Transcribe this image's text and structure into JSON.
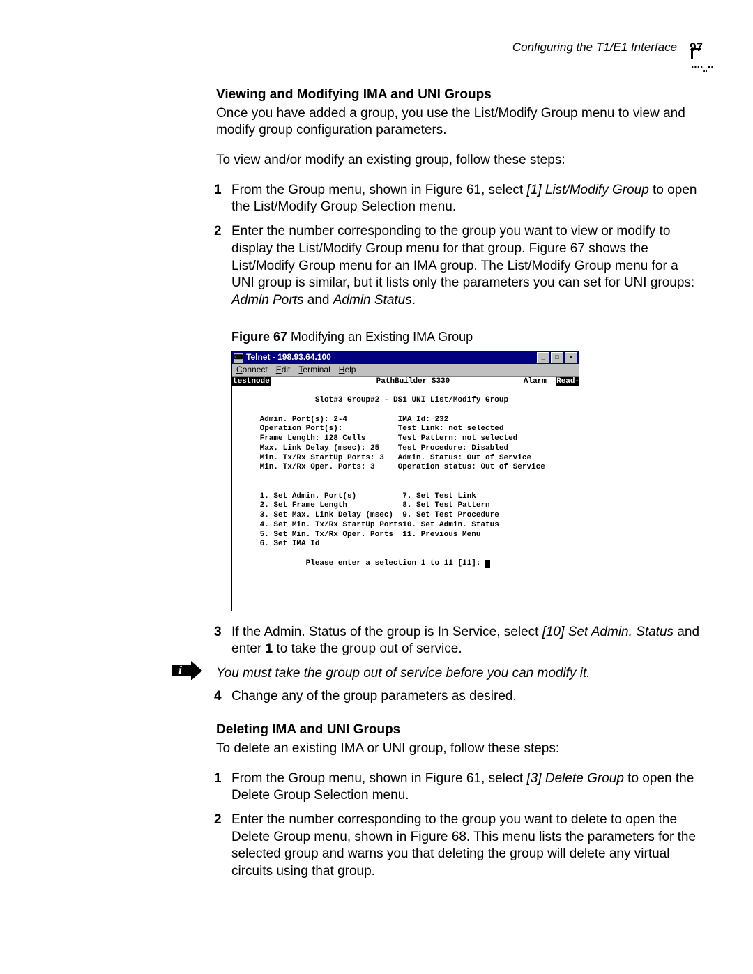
{
  "header": {
    "section": "Configuring the T1/E1 Interface",
    "page": "97"
  },
  "s1": {
    "title": "Viewing and Modifying IMA and UNI Groups",
    "intro1": "Once you have added a group, you use the List/Modify Group menu to view and modify group configuration parameters.",
    "intro2": "To view and/or modify an existing group, follow these steps:",
    "step1_a": "From the Group menu, shown in Figure 61, select ",
    "step1_em": "[1] List/Modify Group",
    "step1_b": " to open the List/Modify Group Selection menu.",
    "step2_a": "Enter the number corresponding to the group you want to view or modify to display the List/Modify Group menu for that group. Figure 67 shows the List/Modify Group menu for an IMA group. The List/Modify Group menu for a UNI group is similar, but it lists only the parameters you can set for UNI groups: ",
    "step2_em1": "Admin Ports",
    "step2_mid": " and ",
    "step2_em2": "Admin Status",
    "step2_end": "."
  },
  "figure": {
    "label": "Figure 67",
    "caption": "   Modifying an Existing IMA Group"
  },
  "telnet": {
    "title": "Telnet - 198.93.64.100",
    "menu": {
      "connect": "Connect",
      "edit": "Edit",
      "terminal": "Terminal",
      "help": "Help"
    },
    "hostname": "testnode",
    "product": "PathBuilder S330",
    "alarm": "Alarm",
    "mode": "Read-Write",
    "subtitle": "Slot#3 Group#2 - DS1 UNI List/Modify Group",
    "params_left": [
      "Admin. Port(s): 2-4",
      "Operation Port(s):",
      "Frame Length: 128 Cells",
      "Max. Link Delay (msec): 25",
      "Min. Tx/Rx StartUp Ports: 3",
      "Min. Tx/Rx Oper. Ports: 3"
    ],
    "params_right": [
      "IMA Id: 232",
      "Test Link: not selected",
      "Test Pattern: not selected",
      "Test Procedure: Disabled",
      "Admin. Status: Out of Service",
      "Operation status: Out of Service"
    ],
    "menu_left": [
      "1. Set Admin. Port(s)",
      "2. Set Frame Length",
      "3. Set Max. Link Delay (msec)",
      "4. Set Min. Tx/Rx StartUp Ports",
      "5. Set Min. Tx/Rx Oper. Ports",
      "6. Set IMA Id"
    ],
    "menu_right": [
      "7. Set Test Link",
      "8. Set Test Pattern",
      "9. Set Test Procedure",
      "10. Set Admin. Status",
      "11. Previous Menu",
      ""
    ],
    "prompt": "Please enter a selection 1 to 11 [11]: "
  },
  "s1b": {
    "step3_a": "If the Admin. Status of the group is In Service, select ",
    "step3_em": "[10] Set Admin. Status",
    "step3_b": " and enter ",
    "step3_bold": "1",
    "step3_c": " to take the group out of service.",
    "note": "You must take the group out of service before you can modify it.",
    "step4": "Change any of the group parameters as desired."
  },
  "s2": {
    "title": "Deleting IMA and UNI Groups",
    "intro": "To delete an existing IMA or UNI group, follow these steps:",
    "step1_a": "From the Group menu, shown in Figure 61, select ",
    "step1_em": "[3] Delete Group",
    "step1_b": " to open the Delete Group Selection menu.",
    "step2": "Enter the number corresponding to the group you want to delete to open the Delete Group menu, shown in Figure 68. This menu lists the parameters for the selected group and warns you that deleting the group will delete any virtual circuits using that group."
  }
}
